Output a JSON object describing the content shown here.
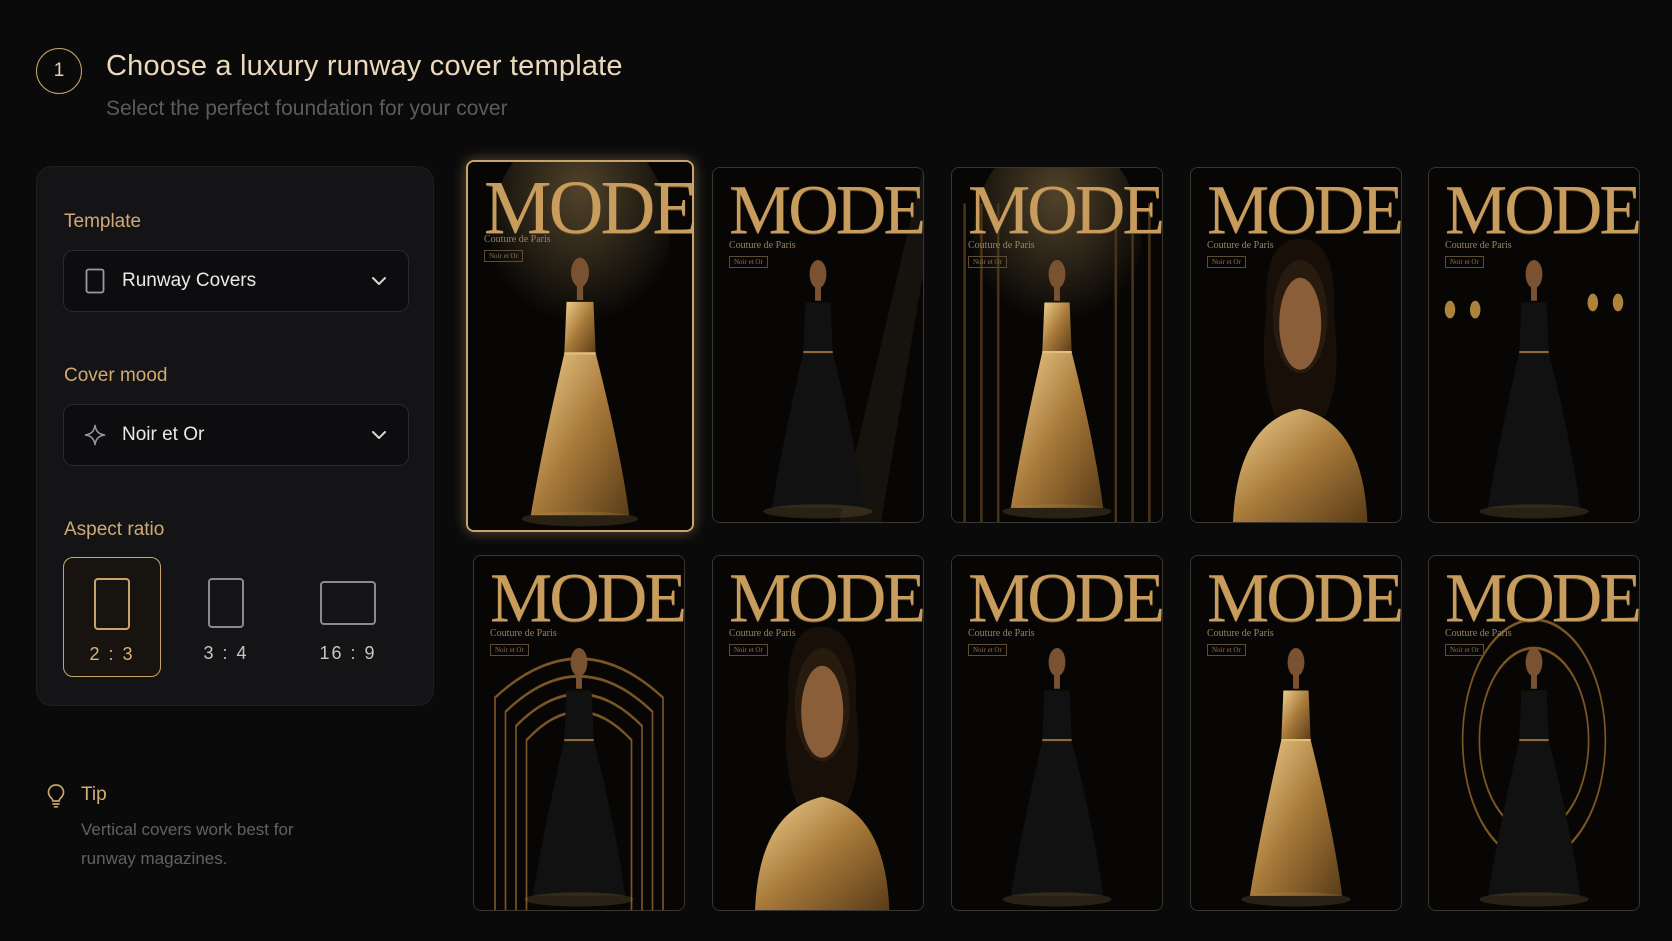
{
  "header": {
    "step": "1",
    "title": "Choose a luxury runway cover template",
    "subtitle": "Select the perfect foundation for your cover"
  },
  "panel": {
    "template_label": "Template",
    "template_value": "Runway Covers",
    "mood_label": "Cover mood",
    "mood_value": "Noir et Or",
    "aspect_label": "Aspect ratio",
    "aspect_options": [
      "2 : 3",
      "3 : 4",
      "16 : 9"
    ],
    "aspect_selected": "2 : 3"
  },
  "tip": {
    "title": "Tip",
    "text": "Vertical covers work best for runway magazines."
  },
  "colors": {
    "accent": "#c9a46a",
    "background": "#0a0a0b",
    "panel": "#141416"
  },
  "cards": [
    {
      "title": "MODE",
      "subtitle": "Couture de Paris",
      "tag": "Noir et Or",
      "selected": true
    },
    {
      "title": "MODE",
      "subtitle": "Couture de Paris",
      "tag": "Noir et Or",
      "selected": false
    },
    {
      "title": "MODE",
      "subtitle": "Couture de Paris",
      "tag": "Noir et Or",
      "selected": false
    },
    {
      "title": "MODE",
      "subtitle": "Couture de Paris",
      "tag": "Noir et Or",
      "selected": false
    },
    {
      "title": "MODE",
      "subtitle": "Couture de Paris",
      "tag": "Noir et Or",
      "selected": false
    },
    {
      "title": "MODE",
      "subtitle": "Couture de Paris",
      "tag": "Noir et Or",
      "selected": false
    },
    {
      "title": "MODE",
      "subtitle": "Couture de Paris",
      "tag": "Noir et Or",
      "selected": false
    },
    {
      "title": "MODE",
      "subtitle": "Couture de Paris",
      "tag": "Noir et Or",
      "selected": false
    },
    {
      "title": "MODE",
      "subtitle": "Couture de Paris",
      "tag": "Noir et Or",
      "selected": false
    },
    {
      "title": "MODE",
      "subtitle": "Couture de Paris",
      "tag": "Noir et Or",
      "selected": false
    }
  ]
}
